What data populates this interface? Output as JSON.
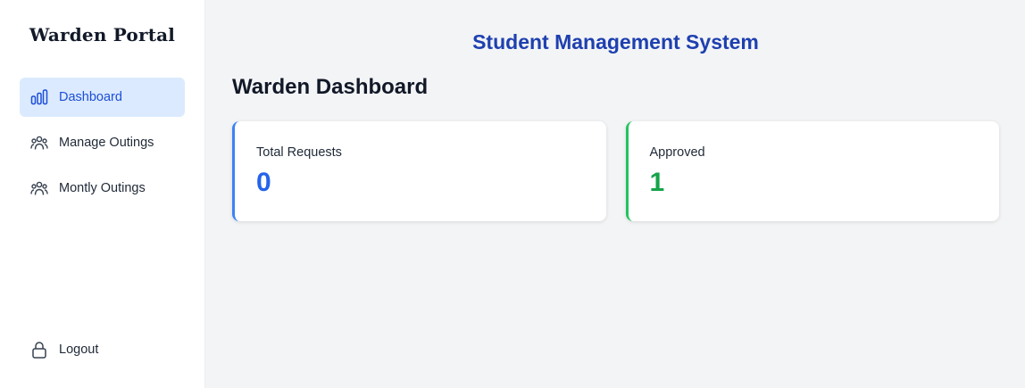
{
  "sidebar": {
    "brand": "Warden Portal",
    "items": [
      {
        "label": "Dashboard",
        "icon": "bar-chart-icon",
        "active": true
      },
      {
        "label": "Manage Outings",
        "icon": "users-icon",
        "active": false
      },
      {
        "label": "Montly Outings",
        "icon": "users-icon",
        "active": false
      }
    ],
    "logout": {
      "label": "Logout",
      "icon": "lock-icon"
    }
  },
  "header": {
    "title": "Student Management System"
  },
  "main": {
    "title": "Warden Dashboard",
    "cards": [
      {
        "label": "Total Requests",
        "value": "0",
        "accent": "#3b82f6"
      },
      {
        "label": "Approved",
        "value": "1",
        "accent": "#22c55e"
      }
    ]
  },
  "colors": {
    "primary": "#1e40af",
    "active_bg": "#dbeafe",
    "blue_accent": "#2563eb",
    "green_accent": "#16a34a"
  }
}
